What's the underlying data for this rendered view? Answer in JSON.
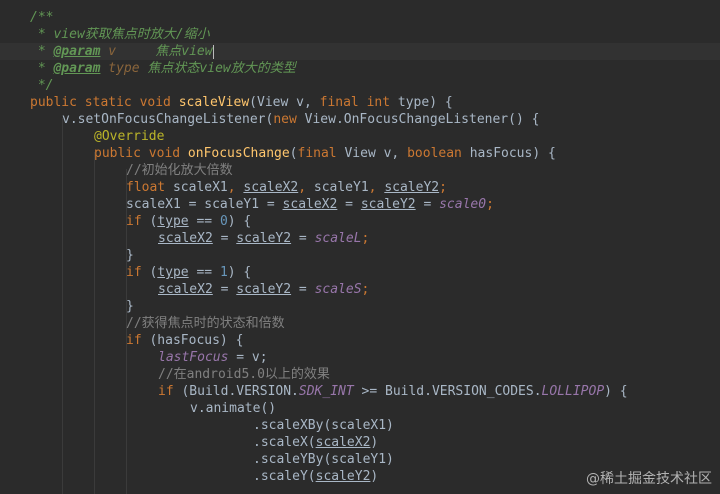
{
  "watermark": "@稀土掘金技术社区",
  "code": {
    "l1": {
      "open": "/**"
    },
    "l2": {
      "star": " * ",
      "text": "view获取焦点时放大/缩小"
    },
    "l3": {
      "star": " * ",
      "tag": "@param",
      "p": " v",
      "desc": "     焦点view"
    },
    "l4": {
      "star": " * ",
      "tag": "@param",
      "p": " type",
      "desc": " 焦点状态view放大的类型"
    },
    "l5": {
      "close": " */"
    },
    "l6": {
      "k1": "public static void ",
      "fn": "scaleView",
      "a": "(View v, ",
      "k2": "final int ",
      "b": "type) {"
    },
    "l7": {
      "a": "v.setOnFocusChangeListener(",
      "k": "new ",
      "b": "View.OnFocusChangeListener() {"
    },
    "l8": {
      "ann": "@Override"
    },
    "l9": {
      "k1": "public void ",
      "fn": "onFocusChange",
      "a": "(",
      "k2": "final ",
      "b": "View v, ",
      "k3": "boolean ",
      "c": "hasFocus) {"
    },
    "l10": {
      "c": "//初始化放大倍数"
    },
    "l11": {
      "k": "float ",
      "a": "scaleX1",
      "p1": ", ",
      "b": "scaleX2",
      "p2": ", ",
      "c": "scaleY1",
      "p3": ", ",
      "d": "scaleY2",
      "p4": ";"
    },
    "l12": {
      "a": "scaleX1 = scaleY1 = ",
      "b": "scaleX2",
      "c": " = ",
      "d": "scaleY2",
      "e": " = ",
      "f": "scale0",
      "p": ";"
    },
    "l13": {
      "k": "if ",
      "a": "(",
      "b": "type",
      "c": " == ",
      "n": "0",
      "d": ") {"
    },
    "l14": {
      "a": "scaleX2",
      "b": " = ",
      "c": "scaleY2",
      "d": " = ",
      "e": "scaleL",
      "p": ";"
    },
    "l15": {
      "a": "}"
    },
    "l16": {
      "k": "if ",
      "a": "(",
      "b": "type",
      "c": " == ",
      "n": "1",
      "d": ") {"
    },
    "l17": {
      "a": "scaleX2",
      "b": " = ",
      "c": "scaleY2",
      "d": " = ",
      "e": "scaleS",
      "p": ";"
    },
    "l18": {
      "a": "}"
    },
    "l19": {
      "c": "//获得焦点时的状态和倍数"
    },
    "l20": {
      "k": "if ",
      "a": "(hasFocus) {"
    },
    "l21": {
      "f": "lastFocus",
      "a": " = v;"
    },
    "l22": {
      "c": "//在android5.0以上的效果"
    },
    "l23": {
      "k": "if ",
      "a": "(Build.VERSION.",
      "f1": "SDK_INT",
      "b": " >= Build.VERSION_CODES.",
      "f2": "LOLLIPOP",
      "c": ") {"
    },
    "l24": {
      "a": "v.animate()"
    },
    "l25": {
      "a": ".scaleXBy(scaleX1)"
    },
    "l26": {
      "a": ".scaleX(",
      "b": "scaleX2",
      "c": ")"
    },
    "l27": {
      "a": ".scaleYBy(scaleY1)"
    },
    "l28": {
      "a": ".scaleY(",
      "b": "scaleY2",
      "c": ")"
    }
  }
}
